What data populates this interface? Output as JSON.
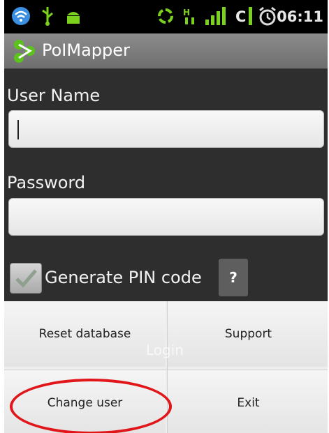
{
  "statusbar": {
    "time": "06:11",
    "carrier_letter": "C",
    "icons": [
      "wifi-icon",
      "usb-icon",
      "android-icon",
      "sync-icon",
      "signal-icon",
      "alarm-icon"
    ]
  },
  "app": {
    "title": "PoIMapper",
    "logo": "poimapper-logo"
  },
  "form": {
    "username_label": "User Name",
    "username_value": "",
    "password_label": "Password",
    "password_value": "",
    "pin_label": "Generate PIN code",
    "pin_checked": true,
    "help_label": "?"
  },
  "menu": {
    "reset": "Reset database",
    "support": "Support",
    "change_user": "Change user",
    "exit": "Exit",
    "login_ghost": "Login"
  },
  "colors": {
    "highlight_circle": "#e0161b"
  }
}
